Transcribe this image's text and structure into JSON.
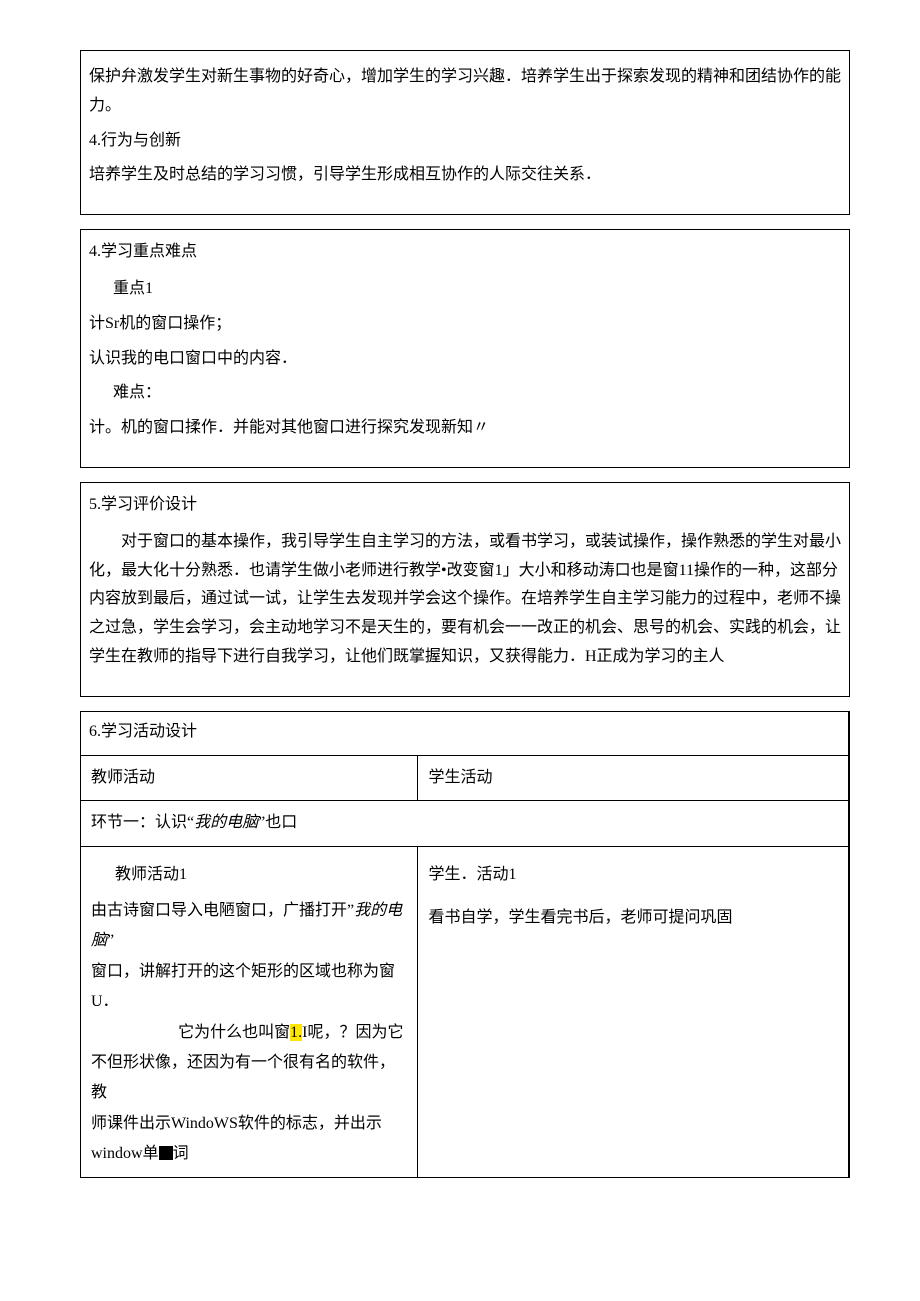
{
  "cell1": {
    "p1": "保护弁激发学生对新生事物的好奇心，增加学生的学习兴趣．培养学生出于探索发现的精神和团结协作的能力。",
    "h": "4.行为与创新",
    "p2": "培养学生及时总结的学习习惯，引导学生形成相互协作的人际交往关系．"
  },
  "cell2": {
    "h": "4.学习重点难点",
    "r1": "重点1",
    "r2": "计Sr机的窗口操作；",
    "r3": "认识我的电口窗口中的内容．",
    "r4": "难点：",
    "r5": "计。机的窗口揉作．并能对其他窗口进行探究发现新知〃"
  },
  "cell3": {
    "h": "5.学习评价设计",
    "p": "对于窗口的基本操作，我引导学生自主学习的方法，或看书学习，或装试操作，操作熟悉的学生对最小化，最大化十分熟悉．也请学生做小老师进行教学•改变窗1」大小和移动涛口也是窗11操作的一种，这部分内容放到最后，通过试一试，让学生去发现并学会这个操作。在培养学生自主学习能力的过程中，老师不操之过急，学生会学习，会主动地学习不是天生的，要有机会一一改正的机会、思号的机会、实践的机会，让学生在教师的指导下进行自我学习，让他们既掌握知识，又获得能力．H正成为学习的主人"
  },
  "activity": {
    "h": "6.学习活动设计",
    "thLeft": "教师活动",
    "thRight": "学生活动",
    "stage": "环节一：认识“",
    "stageItalic": "我的电脑",
    "stageTail": "”也口",
    "tLabel": "教师活动1",
    "sLabel": "学生．活动1",
    "t_l1a": "由古诗窗口导入电陋窗口，广播打开”",
    "t_l1b": "我的电脑",
    "t_l1c": "”",
    "t_l2": "窗口，讲解打开的这个矩形的区域也称为窗U．",
    "t_l3a": "它为什么也叫窗",
    "t_l3b": "1.",
    "t_l3c": "I呢，？因为它",
    "t_l4": "不但形状像，还因为有一个很有名的软件，教",
    "t_l5": "师课件出示WindoWS软件的标志，并出示",
    "t_l6a": "window单",
    "t_l6b": "词",
    "sBody": "看书自学，学生看完书后，老师可提问巩固"
  }
}
